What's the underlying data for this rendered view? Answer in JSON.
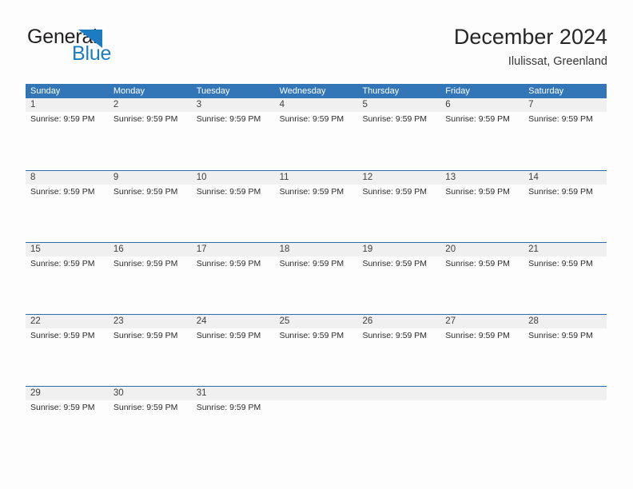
{
  "brand": {
    "name_part1": "General",
    "name_part2": "Blue",
    "triangle_icon": "blue-triangle-icon",
    "dark_color": "#221f1f",
    "blue_color": "#1b7cc2"
  },
  "header": {
    "title": "December 2024",
    "subtitle": "Ilulissat, Greenland"
  },
  "theme": {
    "header_blue": "#3376b7",
    "separator_blue": "#2e6da8",
    "date_band_gray": "#f0f0f0",
    "page_background": "#fdfdfd"
  },
  "calendar": {
    "weekdays": [
      "Sunday",
      "Monday",
      "Tuesday",
      "Wednesday",
      "Thursday",
      "Friday",
      "Saturday"
    ],
    "weeks": [
      {
        "days": [
          {
            "date": "1",
            "event": "Sunrise: 9:59 PM"
          },
          {
            "date": "2",
            "event": "Sunrise: 9:59 PM"
          },
          {
            "date": "3",
            "event": "Sunrise: 9:59 PM"
          },
          {
            "date": "4",
            "event": "Sunrise: 9:59 PM"
          },
          {
            "date": "5",
            "event": "Sunrise: 9:59 PM"
          },
          {
            "date": "6",
            "event": "Sunrise: 9:59 PM"
          },
          {
            "date": "7",
            "event": "Sunrise: 9:59 PM"
          }
        ]
      },
      {
        "days": [
          {
            "date": "8",
            "event": "Sunrise: 9:59 PM"
          },
          {
            "date": "9",
            "event": "Sunrise: 9:59 PM"
          },
          {
            "date": "10",
            "event": "Sunrise: 9:59 PM"
          },
          {
            "date": "11",
            "event": "Sunrise: 9:59 PM"
          },
          {
            "date": "12",
            "event": "Sunrise: 9:59 PM"
          },
          {
            "date": "13",
            "event": "Sunrise: 9:59 PM"
          },
          {
            "date": "14",
            "event": "Sunrise: 9:59 PM"
          }
        ]
      },
      {
        "days": [
          {
            "date": "15",
            "event": "Sunrise: 9:59 PM"
          },
          {
            "date": "16",
            "event": "Sunrise: 9:59 PM"
          },
          {
            "date": "17",
            "event": "Sunrise: 9:59 PM"
          },
          {
            "date": "18",
            "event": "Sunrise: 9:59 PM"
          },
          {
            "date": "19",
            "event": "Sunrise: 9:59 PM"
          },
          {
            "date": "20",
            "event": "Sunrise: 9:59 PM"
          },
          {
            "date": "21",
            "event": "Sunrise: 9:59 PM"
          }
        ]
      },
      {
        "days": [
          {
            "date": "22",
            "event": "Sunrise: 9:59 PM"
          },
          {
            "date": "23",
            "event": "Sunrise: 9:59 PM"
          },
          {
            "date": "24",
            "event": "Sunrise: 9:59 PM"
          },
          {
            "date": "25",
            "event": "Sunrise: 9:59 PM"
          },
          {
            "date": "26",
            "event": "Sunrise: 9:59 PM"
          },
          {
            "date": "27",
            "event": "Sunrise: 9:59 PM"
          },
          {
            "date": "28",
            "event": "Sunrise: 9:59 PM"
          }
        ]
      },
      {
        "days": [
          {
            "date": "29",
            "event": "Sunrise: 9:59 PM"
          },
          {
            "date": "30",
            "event": "Sunrise: 9:59 PM"
          },
          {
            "date": "31",
            "event": "Sunrise: 9:59 PM"
          },
          {
            "date": "",
            "event": ""
          },
          {
            "date": "",
            "event": ""
          },
          {
            "date": "",
            "event": ""
          },
          {
            "date": "",
            "event": ""
          }
        ]
      }
    ]
  }
}
